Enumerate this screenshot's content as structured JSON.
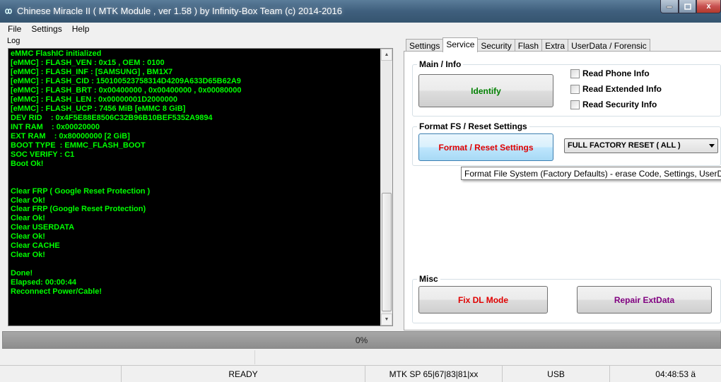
{
  "window": {
    "title": "Chinese Miracle II ( MTK Module , ver 1.58 ) by Infinity-Box Team (c) 2014-2016",
    "buttons": {
      "close": "x"
    }
  },
  "menu": [
    "File",
    "Settings",
    "Help"
  ],
  "log": {
    "label": "Log",
    "lines": [
      "eMMC FlashIC initialized",
      "[eMMC] : FLASH_VEN : 0x15 , OEM : 0100",
      "[eMMC] : FLASH_INF : [SAMSUNG] , BM1X7",
      "[eMMC] : FLASH_CID : 150100523758314D4209A633D65B62A9",
      "[eMMC] : FLASH_BRT : 0x00400000 , 0x00400000 , 0x00080000",
      "[eMMC] : FLASH_LEN : 0x00000001D2000000",
      "[eMMC] : FLASH_UCP : 7456 MiB [eMMC 8 GiB]",
      "DEV RID    : 0x4F5E88E8506C32B96B10BEF5352A9894",
      "INT RAM    : 0x00020000",
      "EXT RAM    : 0x80000000 [2 GiB]",
      "BOOT TYPE  : EMMC_FLASH_BOOT",
      "SOC VERIFY : C1",
      "Boot Ok!",
      "",
      "",
      "Clear FRP ( Google Reset Protection )",
      "Clear Ok!",
      "Clear FRP (Google Reset Protection)",
      "Clear Ok!",
      "Clear USERDATA",
      "Clear Ok!",
      "Clear CACHE",
      "Clear Ok!",
      "",
      "Done!",
      "Elapsed: 00:00:44",
      "Reconnect Power/Cable!"
    ],
    "text_color": "#00ff00"
  },
  "tabs": [
    {
      "label": "Settings",
      "active": false
    },
    {
      "label": "Service",
      "active": true
    },
    {
      "label": "Security",
      "active": false
    },
    {
      "label": "Flash",
      "active": false
    },
    {
      "label": "Extra",
      "active": false
    },
    {
      "label": "UserData / Forensic",
      "active": false
    }
  ],
  "main_info": {
    "title": "Main / Info",
    "identify_label": "Identify",
    "identify_color": "#008000",
    "checks": [
      {
        "label": "Read Phone Info",
        "checked": false
      },
      {
        "label": "Read Extended Info",
        "checked": false
      },
      {
        "label": "Read Security Info",
        "checked": false
      }
    ]
  },
  "format": {
    "title": "Format FS / Reset Settings",
    "button_label": "Format / Reset Settings",
    "button_color": "#e00000",
    "combo_value": "FULL FACTORY RESET ( ALL )",
    "tooltip": "Format File System (Factory Defaults) - erase Code, Settings, UserData"
  },
  "misc": {
    "title": "Misc",
    "fix_label": "Fix DL Mode",
    "fix_color": "#e00000",
    "repair_label": "Repair ExtData",
    "repair_color": "#800080"
  },
  "progress": {
    "value": 0,
    "label": "0%"
  },
  "status": {
    "ready": "READY",
    "platform": "MTK SP 65|67|83|81|xx",
    "connection": "USB",
    "time": "04:48:53 ä"
  }
}
